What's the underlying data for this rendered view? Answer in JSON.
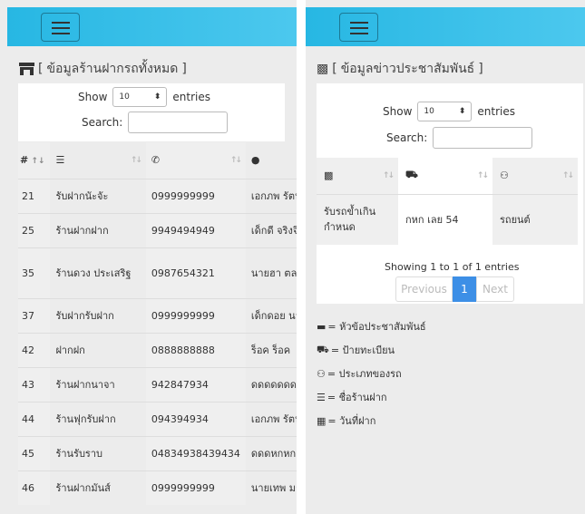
{
  "left_panel": {
    "title_open": "[",
    "title": "ข้อมูลร้านฝากรถทั้งหมด",
    "title_close": "]",
    "show_label": "Show",
    "page_length": "10",
    "entries_label": "entries",
    "search_label": "Search:",
    "search_value": "",
    "header_hash": "#",
    "rows": [
      {
        "id": "21",
        "name": "รับฝากนัะจัะ",
        "phone": "0999999999",
        "owner": "เอกภพ รัตน"
      },
      {
        "id": "25",
        "name": "ร้านฝากฝาก",
        "phone": "9949494949",
        "owner": "เด็กดี จริงจิง"
      },
      {
        "id": "35",
        "name": "ร้านดวง ประเสริฐ",
        "phone": "0987654321",
        "owner": "นายฮา ตลก"
      },
      {
        "id": "37",
        "name": "รับฝากรับฝาก",
        "phone": "0999999999",
        "owner": "เด็กดอย นา"
      },
      {
        "id": "42",
        "name": "ฝากฝก",
        "phone": "0888888888",
        "owner": "ร็อค ร็อค"
      },
      {
        "id": "43",
        "name": "ร้านฝากนาจา",
        "phone": "942847934",
        "owner": "ดดดดดดดด"
      },
      {
        "id": "44",
        "name": "ร้านฟุกรับฝาก",
        "phone": "094394934",
        "owner": "เอกภพ รัตน"
      },
      {
        "id": "45",
        "name": "ร้านรับราบ",
        "phone": "04834938439434",
        "owner": "ดดดหกหก"
      },
      {
        "id": "46",
        "name": "ร้านฝากมันส์",
        "phone": "0999999999",
        "owner": "นายเทพ มา"
      }
    ]
  },
  "right_panel": {
    "title_open": "[",
    "title": "ข้อมูลข่าวประชาสัมพันธ์",
    "title_close": "]",
    "show_label": "Show",
    "page_length": "10",
    "entries_label": "entries",
    "search_label": "Search:",
    "search_value": "",
    "rows": [
      {
        "topic": "รับรถข้ำเกินกำหนด",
        "plate": "กหก เลย 54",
        "type": "รถยนต์"
      }
    ],
    "info": "Showing 1 to 1 of 1 entries",
    "pagination": {
      "previous": "Previous",
      "current": "1",
      "next": "Next"
    },
    "legend": [
      {
        "icon": "comment-icon",
        "text": "= หัวข้อประชาสัมพันธ์"
      },
      {
        "icon": "car-icon",
        "text": "= ป้ายทะเบียน"
      },
      {
        "icon": "motorcycle-icon",
        "text": "= ประเภทของรถ"
      },
      {
        "icon": "flag-icon",
        "text": "= ชื่อร้านฝาก"
      },
      {
        "icon": "calendar-icon",
        "text": "= วันที่ฝาก"
      }
    ]
  },
  "colors": {
    "navbar": "#27b7e3",
    "page_active": "#3d8fe6"
  }
}
